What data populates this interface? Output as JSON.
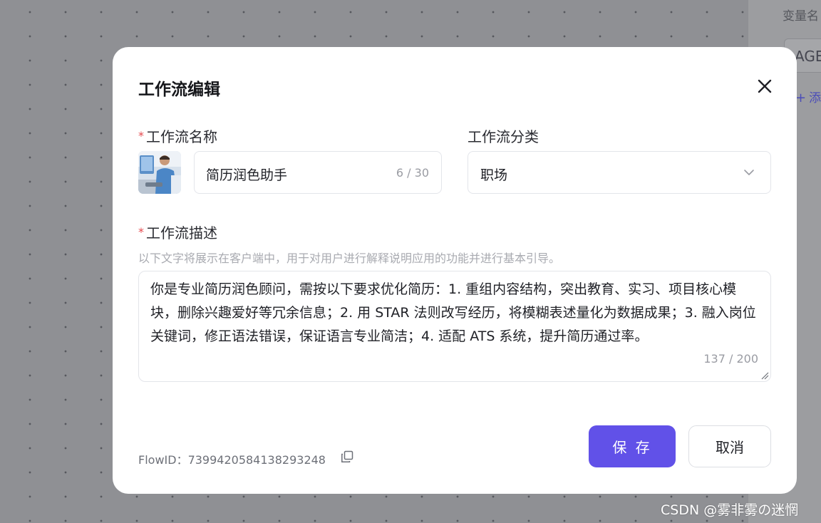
{
  "background": {
    "variable_label": "变量名",
    "variable_input_value": "AGE",
    "add_label": "添"
  },
  "modal": {
    "title": "工作流编辑",
    "name_field": {
      "label": "工作流名称",
      "value": "简历润色助手",
      "counter": "6 / 30"
    },
    "category_field": {
      "label": "工作流分类",
      "selected": "职场"
    },
    "description_field": {
      "label": "工作流描述",
      "hint": "以下文字将展示在客户端中，用于对用户进行解释说明应用的功能并进行基本引导。",
      "value": "你是专业简历润色顾问，需按以下要求优化简历：1. 重组内容结构，突出教育、实习、项目核心模块，删除兴趣爱好等冗余信息；2. 用 STAR 法则改写经历，将模糊表述量化为数据成果；3. 融入岗位关键词，修正语法错误，保证语言专业简洁；4. 适配 ATS 系统，提升简历通过率。",
      "counter": "137 / 200"
    },
    "flow_id": "FlowID：7399420584138293248",
    "save_label": "保 存",
    "cancel_label": "取消"
  },
  "watermark": "CSDN @雾非雾の迷惘",
  "colors": {
    "primary": "#6151e8",
    "required": "#e5484d",
    "overlay": "#8f9094"
  },
  "icons": {
    "close": "close-icon",
    "chevron": "chevron-down-icon",
    "copy": "copy-icon",
    "avatar": "workflow-avatar-image"
  }
}
